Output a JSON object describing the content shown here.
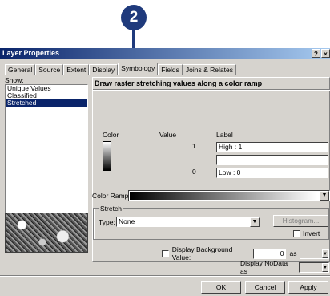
{
  "callout": {
    "number": "2"
  },
  "window": {
    "title": "Layer Properties",
    "help_glyph": "?",
    "close_glyph": "×"
  },
  "tabs": [
    "General",
    "Source",
    "Extent",
    "Display",
    "Symbology",
    "Fields",
    "Joins & Relates"
  ],
  "active_tab": "Symbology",
  "show": {
    "label": "Show:",
    "items": [
      "Unique Values",
      "Classified",
      "Stretched"
    ],
    "selected": "Stretched"
  },
  "panel": {
    "title": "Draw raster stretching values along a color ramp",
    "col_color": "Color",
    "col_value": "Value",
    "col_label": "Label",
    "rows": [
      {
        "value": "1",
        "label": "High : 1"
      },
      {
        "value": "",
        "label": ""
      },
      {
        "value": "0",
        "label": "Low : 0"
      }
    ],
    "color_ramp_label": "Color Ramp:",
    "stretch": {
      "legend": "Stretch",
      "type_label": "Type:",
      "type_value": "None",
      "histogram_label": "Histogram...",
      "invert_label": "Invert"
    },
    "background": {
      "label": "Display Background Value:",
      "value": "0",
      "as_label": "as"
    },
    "nodata": {
      "label": "Display NoData as"
    }
  },
  "buttons": {
    "ok": "OK",
    "cancel": "Cancel",
    "apply": "Apply"
  },
  "colors": {
    "callout": "#1f3a7c",
    "titlebar": "#0a246a",
    "selection": "#0a246a",
    "dialog_bg": "#d6d3ce"
  }
}
